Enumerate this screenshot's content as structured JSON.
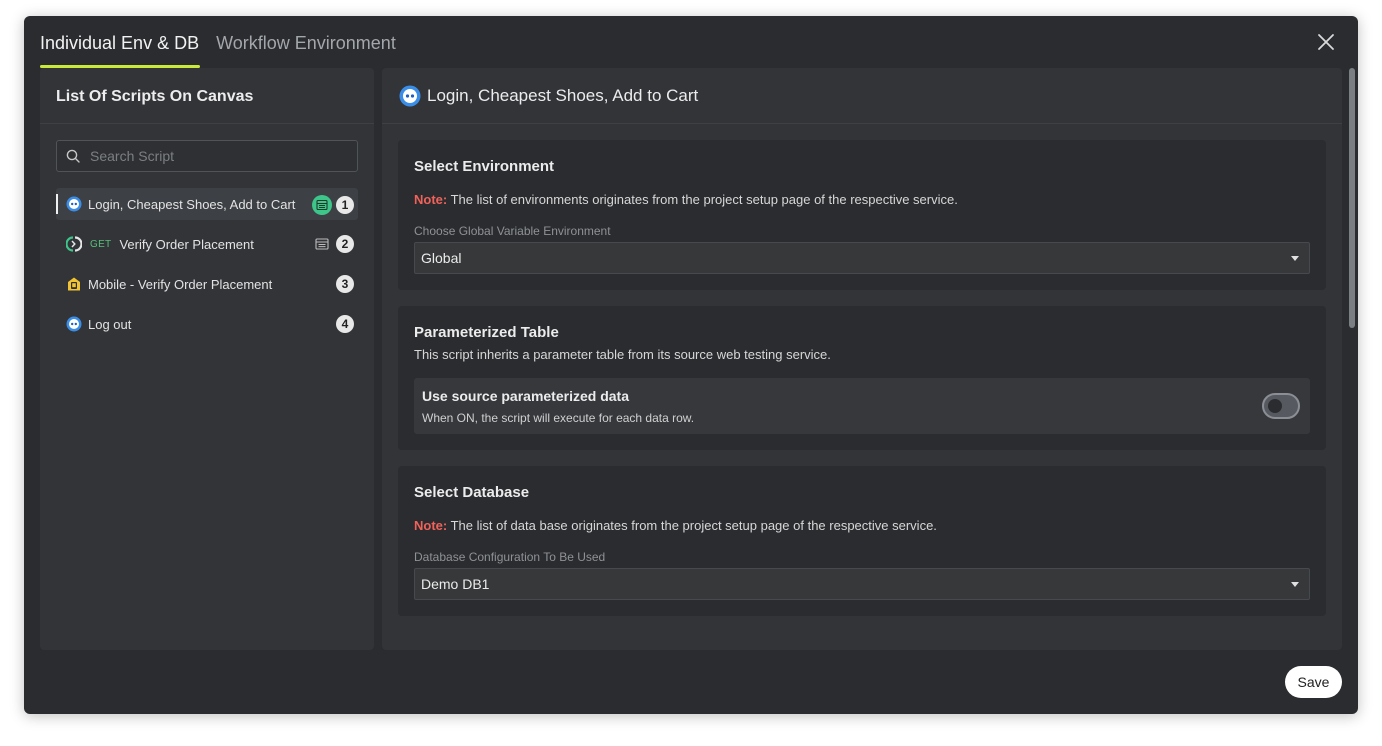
{
  "tabs": [
    {
      "label": "Individual Env & DB",
      "active": true
    },
    {
      "label": "Workflow Environment",
      "active": false
    }
  ],
  "left_panel": {
    "title": "List Of Scripts On Canvas",
    "search_placeholder": "Search Script",
    "scripts": [
      {
        "label": "Login, Cheapest Shoes, Add to Cart",
        "method": "",
        "count": "1",
        "icon": "web-bot-icon",
        "active": true
      },
      {
        "label": "Verify Order Placement",
        "method": "GET",
        "count": "2",
        "icon": "api-icon",
        "active": false
      },
      {
        "label": "Mobile - Verify Order Placement",
        "method": "",
        "count": "3",
        "icon": "mobile-icon",
        "active": false
      },
      {
        "label": "Log out",
        "method": "",
        "count": "4",
        "icon": "web-bot-icon",
        "active": false
      }
    ]
  },
  "right_panel": {
    "title": "Login, Cheapest Shoes, Add to Cart",
    "environment": {
      "title": "Select Environment",
      "note_prefix": "Note:",
      "note_text": " The list of environments originates from the project setup page of the respective service.",
      "field_label": "Choose Global Variable Environment",
      "value": "Global"
    },
    "parameterized": {
      "title": "Parameterized Table",
      "description": "This script inherits a parameter table from its source web testing service.",
      "toggle_title": "Use source parameterized data",
      "toggle_description": "When ON, the script will execute for each data row.",
      "toggle_on": false
    },
    "database": {
      "title": "Select Database",
      "note_prefix": "Note:",
      "note_text": " The list of data base originates from the project setup page of the respective service.",
      "field_label": "Database Configuration To Be Used",
      "value": "Demo DB1"
    }
  },
  "footer": {
    "save_label": "Save"
  },
  "colors": {
    "accent": "#c9ea3a",
    "note_red": "#f0625a",
    "data_badge": "#3ec58a"
  }
}
